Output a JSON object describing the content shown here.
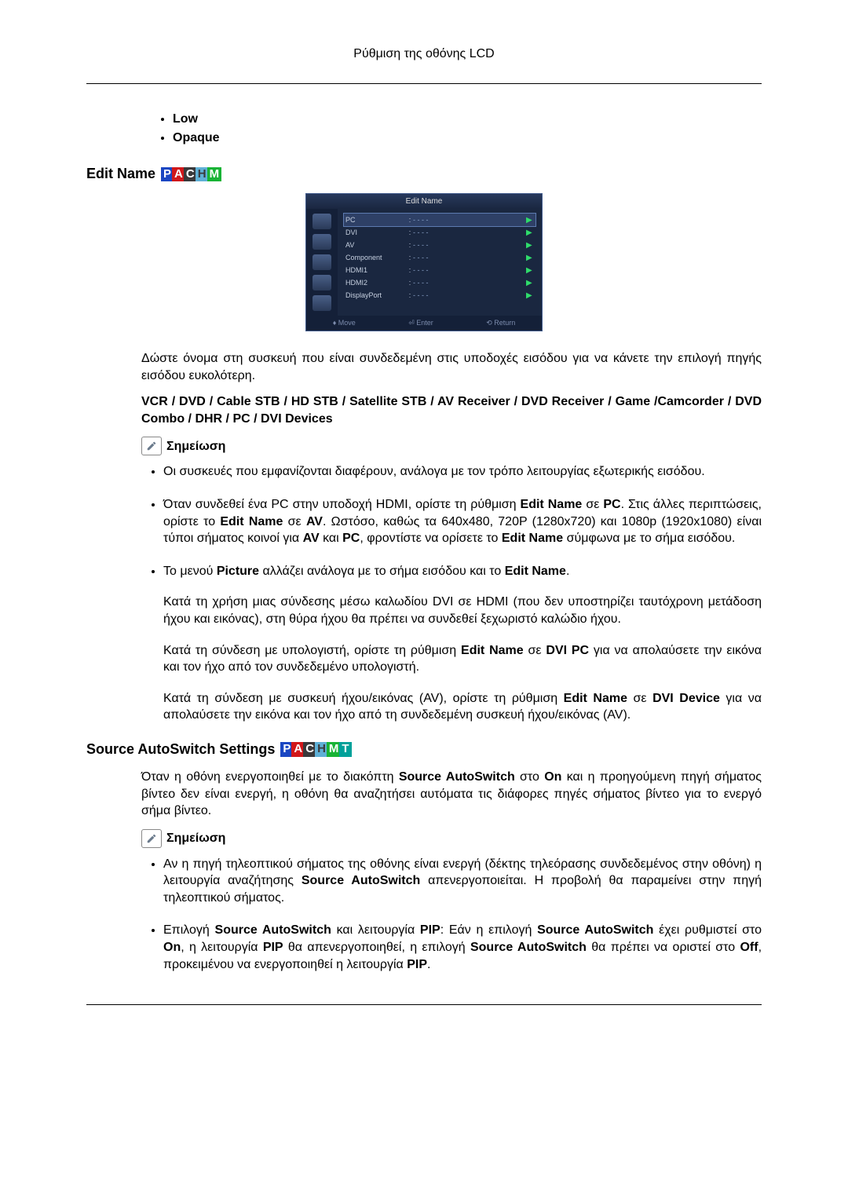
{
  "header": {
    "title": "Ρύθμιση της οθόνης LCD"
  },
  "top_bullets": [
    "Low",
    "Opaque"
  ],
  "section_edit_name": {
    "heading": "Edit Name",
    "badges": [
      "P",
      "A",
      "C",
      "H",
      "M"
    ]
  },
  "osd": {
    "title": "Edit Name",
    "rows": [
      {
        "label": "PC",
        "value": "- - - -",
        "selected": true
      },
      {
        "label": "DVI",
        "value": "- - - -",
        "selected": false
      },
      {
        "label": "AV",
        "value": "- - - -",
        "selected": false
      },
      {
        "label": "Component",
        "value": "- - - -",
        "selected": false
      },
      {
        "label": "HDMI1",
        "value": "- - - -",
        "selected": false
      },
      {
        "label": "HDMI2",
        "value": "- - - -",
        "selected": false
      },
      {
        "label": "DisplayPort",
        "value": "- - - -",
        "selected": false
      }
    ],
    "footer": {
      "move": "Move",
      "enter": "Enter",
      "return": "Return"
    }
  },
  "edit_name_intro": "Δώστε όνομα στη συσκευή που είναι συνδεδεμένη στις υποδοχές εισόδου για να κάνετε την επιλογή πηγής εισόδου ευκολότερη.",
  "device_list": "VCR / DVD / Cable STB / HD STB / Satellite STB / AV Receiver / DVD Receiver / Game /Camcorder / DVD Combo / DHR / PC / DVI Devices",
  "note_label": "Σημείωση",
  "edit_name_bullets": {
    "b1": "Οι συσκευές που εμφανίζονται διαφέρουν, ανάλογα με τον τρόπο λειτουργίας εξωτερικής εισόδου.",
    "b2_pre": "Όταν συνδεθεί ένα PC στην υποδοχή HDMI, ορίστε τη ρύθμιση ",
    "b2_en1": "Edit Name",
    "b2_mid1": " σε ",
    "b2_pc": "PC",
    "b2_mid2": ". Στις άλλες περιπτώσεις, ορίστε το ",
    "b2_en2": "Edit Name",
    "b2_mid3": " σε ",
    "b2_av": "AV",
    "b2_mid4": ". Ωστόσο, καθώς τα 640x480, 720P (1280x720) και 1080p (1920x1080) είναι τύποι σήματος κοινοί για ",
    "b2_av2": "AV",
    "b2_mid5": " και ",
    "b2_pc2": "PC",
    "b2_mid6": ", φροντίστε να ορίσετε το ",
    "b2_en3": "Edit Name",
    "b2_end": " σύμφωνα με το σήμα εισόδου.",
    "b3_pre": "Το μενού ",
    "b3_pic": "Picture",
    "b3_mid": " αλλάζει ανάλογα με το σήμα εισόδου και το ",
    "b3_en": "Edit Name",
    "b3_end": ".",
    "b3_p2": "Κατά τη χρήση μιας σύνδεσης μέσω καλωδίου DVI σε HDMI (που δεν υποστηρίζει ταυτόχρονη μετάδοση ήχου και εικόνας), στη θύρα ήχου θα πρέπει να συνδεθεί ξεχωριστό καλώδιο ήχου.",
    "b3_p3_pre": "Κατά τη σύνδεση με υπολογιστή, ορίστε τη ρύθμιση ",
    "b3_p3_en": "Edit Name",
    "b3_p3_mid": " σε ",
    "b3_p3_dvipc": "DVI PC",
    "b3_p3_end": " για να απολαύσετε την εικόνα και τον ήχο από τον συνδεδεμένο υπολογιστή.",
    "b3_p4_pre": "Κατά τη σύνδεση με συσκευή ήχου/εικόνας (AV), ορίστε τη ρύθμιση ",
    "b3_p4_en": "Edit Name",
    "b3_p4_mid": " σε ",
    "b3_p4_dvidev": "DVI Device",
    "b3_p4_end": " για να απολαύσετε την εικόνα και τον ήχο από τη συνδεδεμένη συσκευή ήχου/εικόνας (AV)."
  },
  "section_autoswitch": {
    "heading": "Source AutoSwitch Settings",
    "badges": [
      "P",
      "A",
      "C",
      "H",
      "M",
      "T"
    ]
  },
  "autoswitch_intro_pre": "Όταν η οθόνη ενεργοποιηθεί με το διακόπτη ",
  "autoswitch_intro_sas1": "Source AutoSwitch",
  "autoswitch_intro_mid": " στο ",
  "autoswitch_intro_on": "On",
  "autoswitch_intro_end": " και η προηγούμενη πηγή σήματος βίντεο δεν είναι ενεργή, η οθόνη θα αναζητήσει αυτόματα τις διάφορες πηγές σήματος βίντεο για το ενεργό σήμα βίντεο.",
  "autoswitch_bullets": {
    "b1_pre": "Αν η πηγή τηλεοπτικού σήματος της οθόνης είναι ενεργή (δέκτης τηλεόρασης συνδεδεμένος στην οθόνη) η λειτουργία αναζήτησης ",
    "b1_sas": "Source AutoSwitch",
    "b1_end": " απενεργοποιείται. Η προβολή θα παραμείνει στην πηγή τηλεοπτικού σήματος.",
    "b2_pre": "Επιλογή ",
    "b2_sas1": "Source AutoSwitch",
    "b2_mid1": " και λειτουργία ",
    "b2_pip1": "PIP",
    "b2_mid2": ": Εάν η επιλογή ",
    "b2_sas2": "Source AutoSwitch",
    "b2_mid3": " έχει ρυθμιστεί στο ",
    "b2_on": "On",
    "b2_mid4": ", η λειτουργία ",
    "b2_pip2": "PIP",
    "b2_mid5": " θα απενεργοποιηθεί, η επιλογή ",
    "b2_sas3": "Source AutoS­witch",
    "b2_mid6": " θα πρέπει να οριστεί στο ",
    "b2_off": "Off",
    "b2_mid7": ", προκειμένου να ενεργοποιηθεί η λειτουργία ",
    "b2_pip3": "PIP",
    "b2_end": "."
  }
}
